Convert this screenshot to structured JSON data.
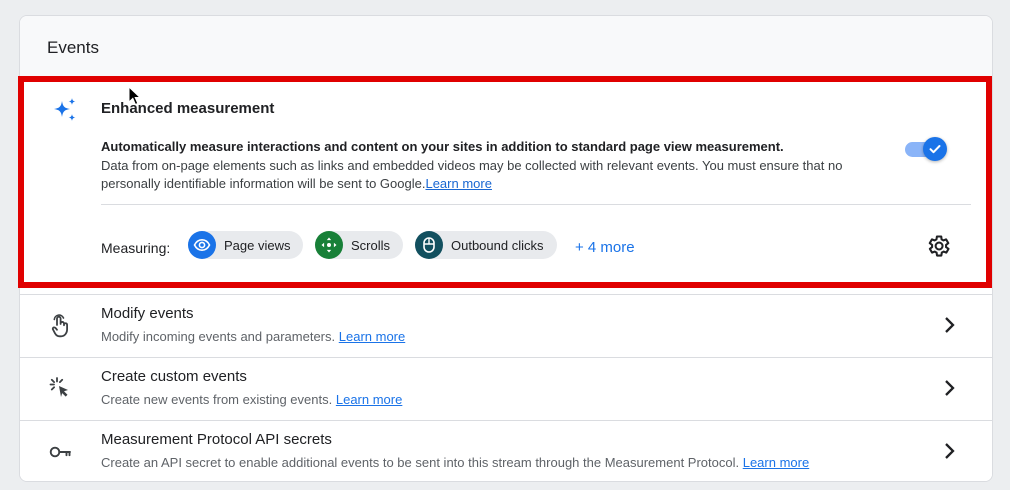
{
  "card": {
    "title": "Events"
  },
  "enhanced": {
    "title": "Enhanced measurement",
    "desc_bold": "Automatically measure interactions and content on your sites in addition to standard page view measurement.",
    "desc_text": "Data from on-page elements such as links and embedded videos may be collected with relevant events. You must ensure that no personally identifiable information will be sent to Google.",
    "learn_more": "Learn more",
    "toggle_on": true,
    "measuring_label": "Measuring:",
    "chips": [
      {
        "label": "Page views",
        "icon": "eye-icon",
        "color": "#1a73e8"
      },
      {
        "label": "Scrolls",
        "icon": "scroll-arrows-icon",
        "color": "#188038"
      },
      {
        "label": "Outbound clicks",
        "icon": "mouse-icon",
        "color": "#12505f"
      }
    ],
    "more": "+ 4 more"
  },
  "rows": [
    {
      "title": "Modify events",
      "subtitle": "Modify incoming events and parameters.",
      "link": "Learn more",
      "icon": "touch-hand-icon"
    },
    {
      "title": "Create custom events",
      "subtitle": "Create new events from existing events.",
      "link": "Learn more",
      "icon": "click-sparkle-icon"
    },
    {
      "title": "Measurement Protocol API secrets",
      "subtitle": "Create an API secret to enable additional events to be sent into this stream through the Measurement Protocol.",
      "link": "Learn more",
      "icon": "key-icon"
    }
  ],
  "colors": {
    "highlight": "#e00000",
    "accent": "#1a73e8"
  }
}
